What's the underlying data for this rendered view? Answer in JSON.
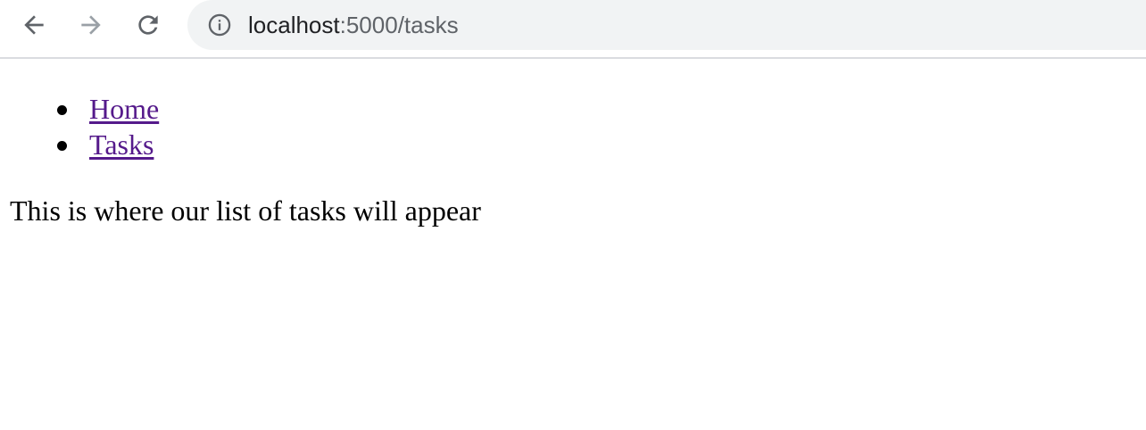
{
  "browser": {
    "icons": {
      "back": "arrow-left-icon",
      "forward": "arrow-right-icon",
      "reload": "reload-icon",
      "info": "info-circle-icon"
    },
    "url_host": "localhost",
    "url_rest": ":5000/tasks"
  },
  "page": {
    "nav": [
      {
        "label": "Home"
      },
      {
        "label": "Tasks"
      }
    ],
    "body_text": "This is where our list of tasks will appear"
  },
  "colors": {
    "link_visited": "#551a8b",
    "omnibox_bg": "#f1f3f4",
    "icon_gray": "#5f6368",
    "icon_disabled": "#9aa0a6"
  }
}
